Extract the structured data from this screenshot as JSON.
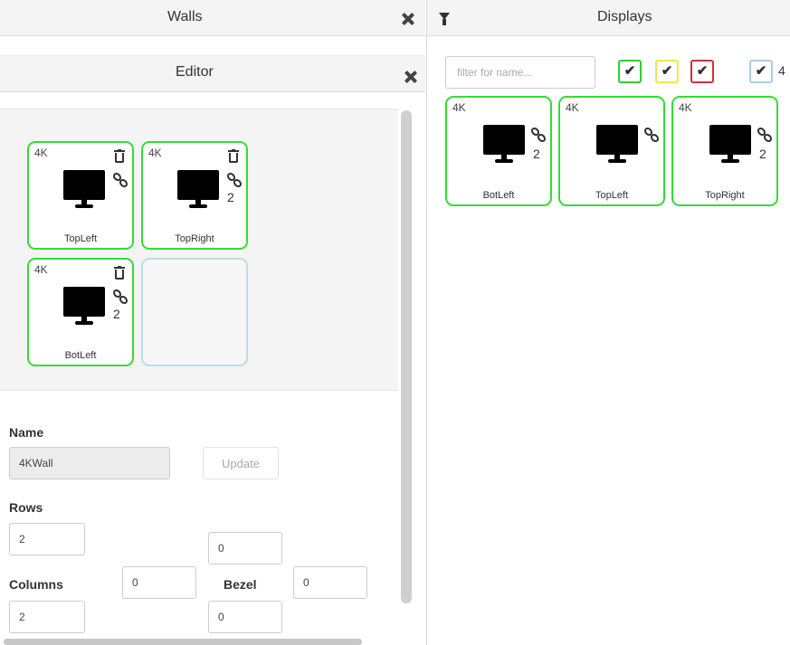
{
  "walls_panel": {
    "title": "Walls"
  },
  "editor_panel": {
    "title": "Editor"
  },
  "wall_grid": {
    "tiles": [
      {
        "resolution": "4K",
        "name": "TopLeft",
        "count": ""
      },
      {
        "resolution": "4K",
        "name": "TopRight",
        "count": "2"
      },
      {
        "resolution": "4K",
        "name": "BotLeft",
        "count": "2"
      }
    ]
  },
  "form": {
    "name_label": "Name",
    "name_value": "4KWall",
    "update_label": "Update",
    "rows_label": "Rows",
    "rows_value": "2",
    "rows_extra_value": "0",
    "columns_label": "Columns",
    "columns_value": "2",
    "columns_extra_value": "0",
    "columns_bottom_value": "0",
    "bezel_label": "Bezel",
    "bezel_value": "0"
  },
  "displays_panel": {
    "title": "Displays",
    "filter_placeholder": "filter for name...",
    "checkboxes": [
      {
        "color": "#33cc33",
        "mark": "✔"
      },
      {
        "color": "#f2e64a",
        "mark": "✔"
      },
      {
        "color": "#d0303a",
        "mark": "✔"
      },
      {
        "color": "#a8cfe0",
        "mark": "✔"
      }
    ],
    "checkbox_count": "4",
    "tiles": [
      {
        "resolution": "4K",
        "name": "BotLeft",
        "count": "2"
      },
      {
        "resolution": "4K",
        "name": "TopLeft",
        "count": ""
      },
      {
        "resolution": "4K",
        "name": "TopRight",
        "count": "2"
      }
    ]
  }
}
